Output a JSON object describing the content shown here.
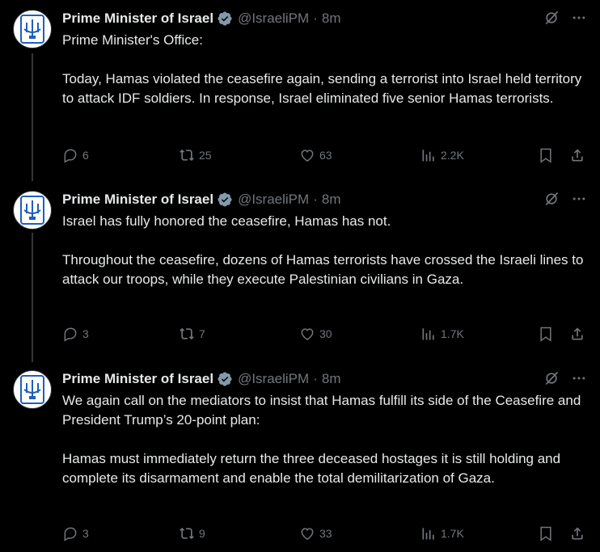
{
  "author": {
    "name": "Prime Minister of Israel",
    "handle": "@IsraeliPM",
    "separator": "·"
  },
  "posts": [
    {
      "time": "8m",
      "text": "Prime Minister's Office:\n\nToday, Hamas violated the ceasefire again, sending a terrorist into Israel held territory to attack IDF soldiers. In response, Israel eliminated five senior Hamas terrorists.",
      "replies": "6",
      "reposts": "25",
      "likes": "63",
      "views": "2.2K"
    },
    {
      "time": "8m",
      "text": "Israel has fully honored the ceasefire, Hamas has not.\n\nThroughout the ceasefire, dozens of Hamas terrorists have crossed the Israeli lines to attack our troops, while they execute Palestinian civilians in Gaza.",
      "replies": "3",
      "reposts": "7",
      "likes": "30",
      "views": "1.7K"
    },
    {
      "time": "8m",
      "text": "We again call on the mediators to insist that Hamas fulfill its side of the Ceasefire and President Trump’s 20-point plan:\n\nHamas must immediately return the three deceased hostages it is still holding and complete its disarmament and enable the total demilitarization of Gaza.",
      "replies": "3",
      "reposts": "9",
      "likes": "33",
      "views": "1.7K"
    }
  ],
  "colors": {
    "background": "#000000",
    "text": "#e7e9ea",
    "secondary": "#71767b",
    "verified_badge": "#829aab",
    "emblem": "#1f5fb8"
  },
  "icons": {
    "verified": "verified-badge-icon",
    "grok": "grok-icon",
    "more": "more-icon",
    "reply": "reply-icon",
    "repost": "repost-icon",
    "like": "like-icon",
    "views": "views-icon",
    "bookmark": "bookmark-icon",
    "share": "share-icon"
  }
}
